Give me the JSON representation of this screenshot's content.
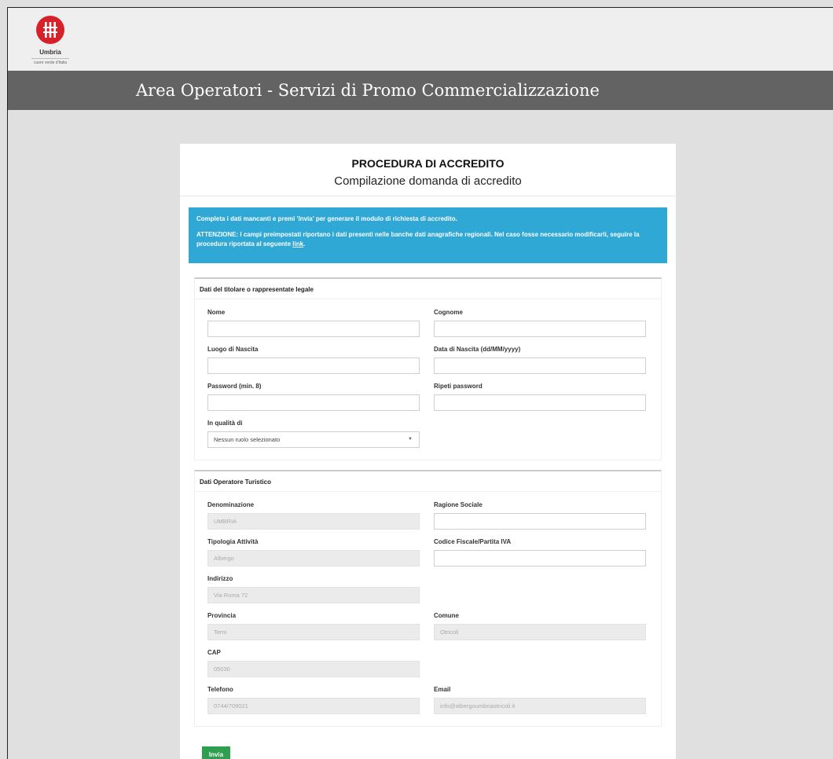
{
  "logo": {
    "name": "Umbria",
    "tagline": "cuore verde d'Italia"
  },
  "banner": {
    "title": "Area Operatori - Servizi di Promo Commercializzazione"
  },
  "card": {
    "title": "PROCEDURA DI ACCREDITO",
    "subtitle": "Compilazione domanda di accredito"
  },
  "alert": {
    "line1": "Completa i dati mancanti e premi 'Invia' per generare il modulo di richiesta di accredito.",
    "line2_prefix": "ATTENZIONE: I campi preimpostati riportano i dati presenti nelle banche dati anagrafiche regionali. Nel caso fosse necessario modificarli, seguire la procedura riportata al seguente ",
    "link": "link",
    "line2_suffix": "."
  },
  "section1": {
    "title": "Dati del titolare o rappresentate legale",
    "nome": {
      "label": "Nome",
      "value": ""
    },
    "cognome": {
      "label": "Cognome",
      "value": ""
    },
    "luogo": {
      "label": "Luogo di Nascita",
      "value": ""
    },
    "data": {
      "label": "Data di Nascita (dd/MM/yyyy)",
      "value": ""
    },
    "password": {
      "label": "Password (min. 8)",
      "value": ""
    },
    "ripeti": {
      "label": "Ripeti password",
      "value": ""
    },
    "qualita": {
      "label": "In qualità di",
      "value": "Nessun ruolo selezionato"
    }
  },
  "section2": {
    "title": "Dati Operatore Turistico",
    "denominazione": {
      "label": "Denominazione",
      "value": "UMBRIA"
    },
    "ragione": {
      "label": "Ragione Sociale",
      "value": ""
    },
    "tipologia": {
      "label": "Tipologia Attività",
      "value": "Albergo"
    },
    "codice": {
      "label": "Codice Fiscale/Partita IVA",
      "value": ""
    },
    "indirizzo": {
      "label": "Indirizzo",
      "value": "Via Roma 72"
    },
    "provincia": {
      "label": "Provincia",
      "value": "Terni"
    },
    "comune": {
      "label": "Comune",
      "value": "Otricoli"
    },
    "cap": {
      "label": "CAP",
      "value": "05030"
    },
    "telefono": {
      "label": "Telefono",
      "value": "0744/709021"
    },
    "email": {
      "label": "Email",
      "value": "info@albergoumbriaotricoli.it"
    }
  },
  "buttons": {
    "send": "Invia"
  },
  "colors": {
    "alert": "#2fa8d6",
    "send": "#2e9e4f",
    "banner": "#636363",
    "logo": "#d8202b"
  }
}
